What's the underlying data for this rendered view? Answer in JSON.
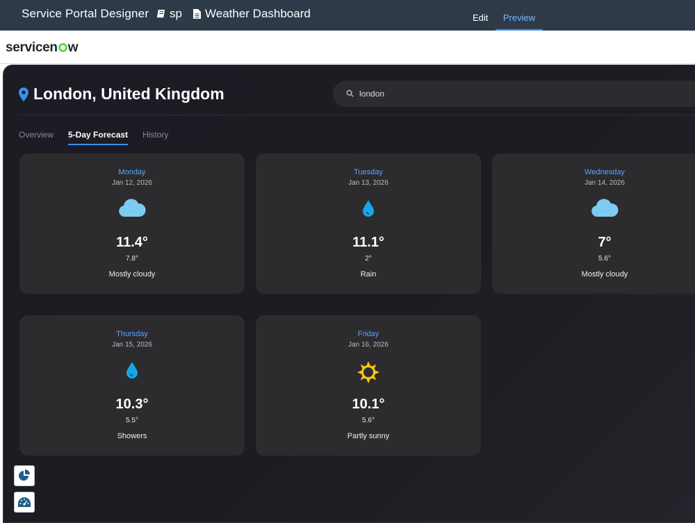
{
  "designer": {
    "title": "Service Portal Designer",
    "portal": "sp",
    "page": "Weather Dashboard",
    "tabs": {
      "edit": "Edit",
      "preview": "Preview"
    }
  },
  "brand": {
    "logo_left": "servicen",
    "logo_right": "w",
    "accent": "#62d84e"
  },
  "location": {
    "name": "London, United Kingdom"
  },
  "search": {
    "value": "london"
  },
  "tabs": [
    "Overview",
    "5-Day Forecast",
    "History"
  ],
  "active_tab": "5-Day Forecast",
  "forecast": [
    {
      "day": "Monday",
      "date": "Jan 12, 2026",
      "icon": "cloud-icon",
      "high": "11.4°",
      "low": "7.8°",
      "condition": "Mostly cloudy"
    },
    {
      "day": "Tuesday",
      "date": "Jan 13, 2026",
      "icon": "raindrop-icon",
      "high": "11.1°",
      "low": "2°",
      "condition": "Rain"
    },
    {
      "day": "Wednesday",
      "date": "Jan 14, 2026",
      "icon": "cloud-icon",
      "high": "7°",
      "low": "5.6°",
      "condition": "Mostly cloudy"
    },
    {
      "day": "Thursday",
      "date": "Jan 15, 2026",
      "icon": "raindrop-icon",
      "high": "10.3°",
      "low": "5.5°",
      "condition": "Showers"
    },
    {
      "day": "Friday",
      "date": "Jan 16, 2026",
      "icon": "sun-icon",
      "high": "10.1°",
      "low": "5.6°",
      "condition": "Partly sunny"
    }
  ],
  "sidebar_buttons": [
    {
      "icon": "pie-chart-icon"
    },
    {
      "icon": "dashboard-gauge-icon"
    }
  ],
  "colors": {
    "accent": "#3b8ff0",
    "day_label": "#5aa3ff",
    "card_bg": "#2c2c2e",
    "app_bg": "#1c1c22"
  }
}
